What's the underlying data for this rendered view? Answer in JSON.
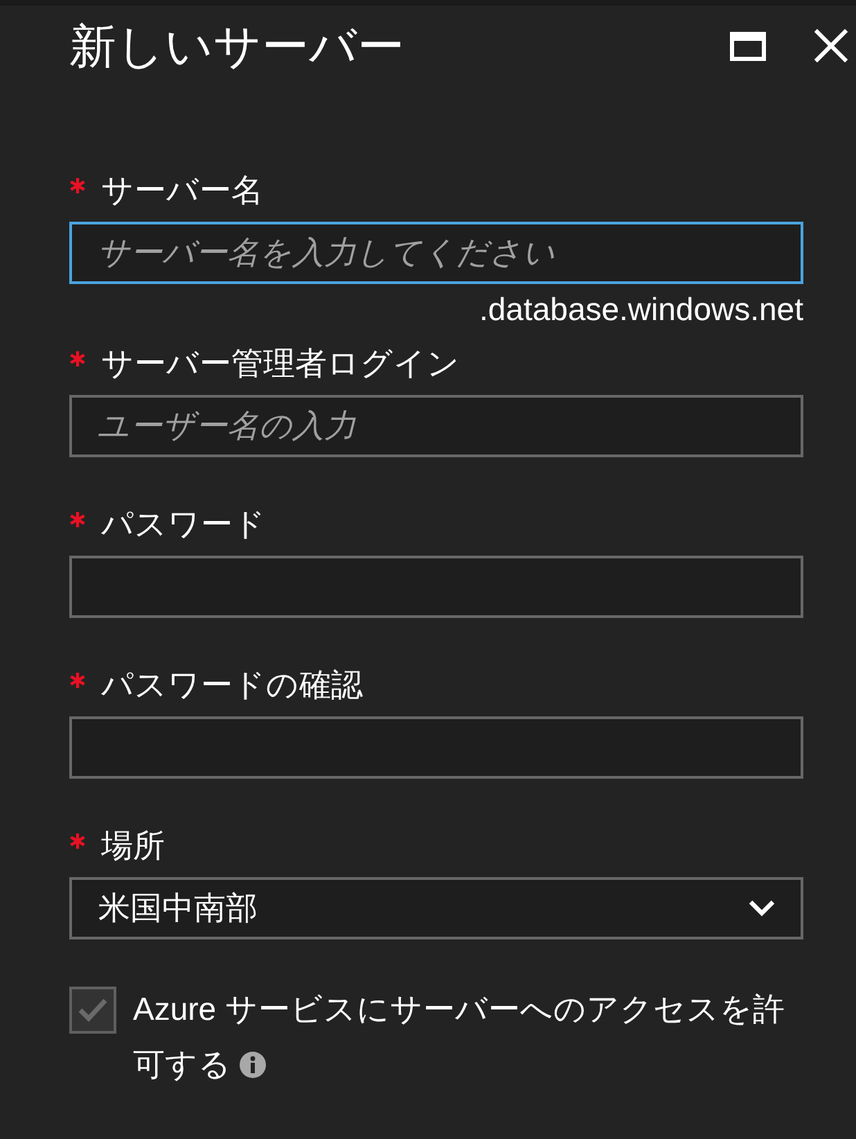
{
  "panel": {
    "title": "新しいサーバー",
    "controls": [
      {
        "kind": "maximize"
      },
      {
        "kind": "close"
      }
    ]
  },
  "fields": [
    {
      "kind": "text",
      "label": "サーバー名",
      "required": true,
      "placeholder": "サーバー名を入力してください",
      "focused": true,
      "suffix": ".database.windows.net"
    },
    {
      "kind": "text",
      "label": "サーバー管理者ログイン",
      "required": true,
      "placeholder": "ユーザー名の入力",
      "focused": false
    },
    {
      "kind": "password",
      "label": "パスワード",
      "required": true,
      "focused": false
    },
    {
      "kind": "password",
      "label": "パスワードの確認",
      "required": true,
      "focused": false
    },
    {
      "kind": "select",
      "label": "場所",
      "required": true,
      "value": "米国中南部"
    }
  ],
  "options": [
    {
      "kind": "checkbox",
      "label": "Azure サービスにサーバーへのアクセスを許可する",
      "checked": true,
      "disabled": true,
      "info": true
    }
  ]
}
